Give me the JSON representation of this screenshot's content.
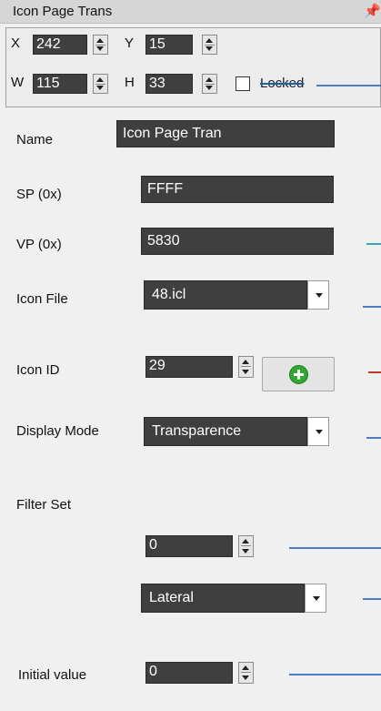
{
  "window": {
    "title": "Icon Page Trans",
    "pin_icon": "pin-icon"
  },
  "geometry": {
    "x_label": "X",
    "x_value": "242",
    "y_label": "Y",
    "y_value": "15",
    "w_label": "W",
    "w_value": "115",
    "h_label": "H",
    "h_value": "33",
    "locked_label": "Locked",
    "locked_checked": false
  },
  "props": {
    "name_label": "Name",
    "name_value": "Icon Page Tran",
    "sp_label": "SP (0x)",
    "sp_value": "FFFF",
    "vp_label": "VP (0x)",
    "vp_value": "5830",
    "iconfile_label": "Icon File",
    "iconfile_value": "48.icl",
    "iconid_label": "Icon ID",
    "iconid_value": "29",
    "displaymode_label": "Display Mode",
    "displaymode_value": "Transparence",
    "filterset_label": "Filter Set",
    "filterset_value": "0",
    "filtermode_value": "Lateral",
    "initial_label": "Initial value",
    "initial_value": "0"
  },
  "colors": {
    "field_bg": "#3f3f3f",
    "connector_blue": "#4a7fc1",
    "connector_teal": "#3aa7b5",
    "connector_red": "#c0392b",
    "add_icon_green": "#2fa82f"
  }
}
